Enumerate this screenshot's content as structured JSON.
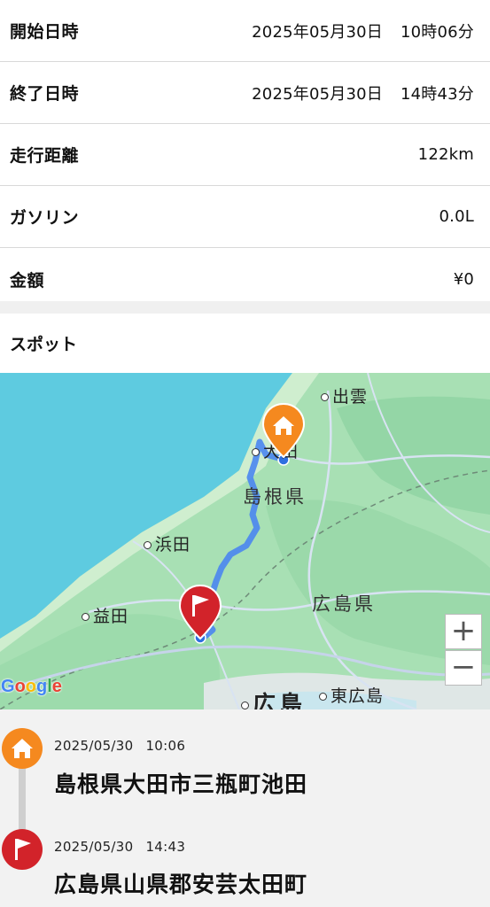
{
  "trip": {
    "rows": [
      {
        "label": "開始日時",
        "date": "2025年05月30日",
        "time": "10時06分"
      },
      {
        "label": "終了日時",
        "date": "2025年05月30日",
        "time": "14時43分"
      }
    ],
    "distance": {
      "label": "走行距離",
      "value": "122km"
    },
    "gasoline": {
      "label": "ガソリン",
      "value": "0.0L"
    },
    "amount": {
      "label": "金額",
      "value": "¥0"
    }
  },
  "spot": {
    "title": "スポット"
  },
  "map": {
    "labels": {
      "izumo": "出雲",
      "ota": "大田",
      "shimane": "島根県",
      "hamada": "浜田",
      "masuda": "益田",
      "hiroshima_pref": "広島県",
      "higashihiroshima": "東広島",
      "hiroshima": "広島"
    },
    "zoom_in": "+",
    "zoom_out": "−",
    "attribution": [
      "G",
      "o",
      "o",
      "g",
      "l",
      "e"
    ],
    "colors": {
      "sea": "#5ecbe0",
      "land": "#a8e0b4",
      "route": "#4a86f0",
      "start": "#f5891f",
      "goal": "#d2232a"
    }
  },
  "timeline": {
    "start": {
      "time_date": "2025/05/30",
      "time_clock": "10:06",
      "place": "島根県大田市三瓶町池田",
      "icon": "home-icon"
    },
    "goal": {
      "time_date": "2025/05/30",
      "time_clock": "14:43",
      "place": "広島県山県郡安芸太田町",
      "icon": "flag-icon"
    }
  }
}
